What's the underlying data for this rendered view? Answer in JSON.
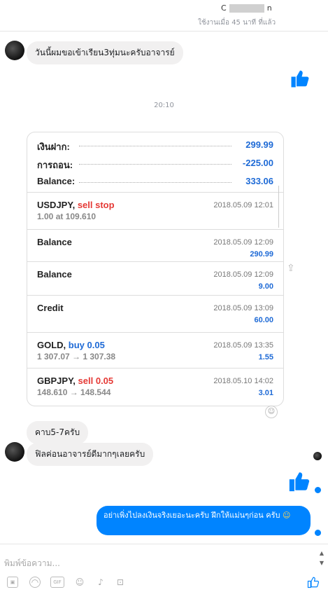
{
  "header": {
    "name_first": "C",
    "name_last": "n",
    "status": "ใช้งานเมื่อ 45 นาที ที่แล้ว"
  },
  "messages": {
    "in_1": "วันนี้ผมขอเข้าเรียน3ทุ่มนะครับอาจารย์",
    "timestamp": "20:10",
    "in_2": "คาบ5-7ครับ",
    "in_3": "ฟิลค่อนอาจารย์ดีมากๆเลยครับ",
    "out_1": "อย่าเพิ่งไปลงเงินจริงเยอะนะครับ ฝึกให้แม่นๆก่อน ครับ",
    "out_1_emoji": "☺"
  },
  "statement": {
    "summary": [
      {
        "label": "เงินฝาก:",
        "value": "299.99"
      },
      {
        "label": "การถอน:",
        "value": "-225.00"
      },
      {
        "label": "Balance:",
        "value": "333.06"
      }
    ],
    "transactions": [
      {
        "symbol": "USDJPY,",
        "action": "sell stop",
        "action_color": "red",
        "detail": "1.00 at 109.610",
        "date": "2018.05.09 12:01",
        "amount": ""
      },
      {
        "symbol": "Balance",
        "action": "",
        "action_color": "",
        "detail": "",
        "date": "2018.05.09 12:09",
        "amount": "290.99"
      },
      {
        "symbol": "Balance",
        "action": "",
        "action_color": "",
        "detail": "",
        "date": "2018.05.09 12:09",
        "amount": "9.00"
      },
      {
        "symbol": "Credit",
        "action": "",
        "action_color": "",
        "detail": "",
        "date": "2018.05.09 13:09",
        "amount": "60.00"
      },
      {
        "symbol": "GOLD,",
        "action": "buy 0.05",
        "action_color": "blue",
        "detail": "1 307.07 → 1 307.38",
        "date": "2018.05.09 13:35",
        "amount": "1.55"
      },
      {
        "symbol": "GBPJPY,",
        "action": "sell 0.05",
        "action_color": "red",
        "detail": "148.610 → 148.544",
        "date": "2018.05.10 14:02",
        "amount": "3.01"
      }
    ]
  },
  "composer": {
    "placeholder": "พิมพ์ข้อความ...",
    "gif_label": "GIF",
    "tools": [
      "image-icon",
      "sticker-icon",
      "gif-icon",
      "emoji-icon",
      "mic-icon",
      "game-icon"
    ]
  },
  "colors": {
    "accent": "#0084ff",
    "statement_blue": "#1e6ad6",
    "statement_red": "#e53935"
  }
}
